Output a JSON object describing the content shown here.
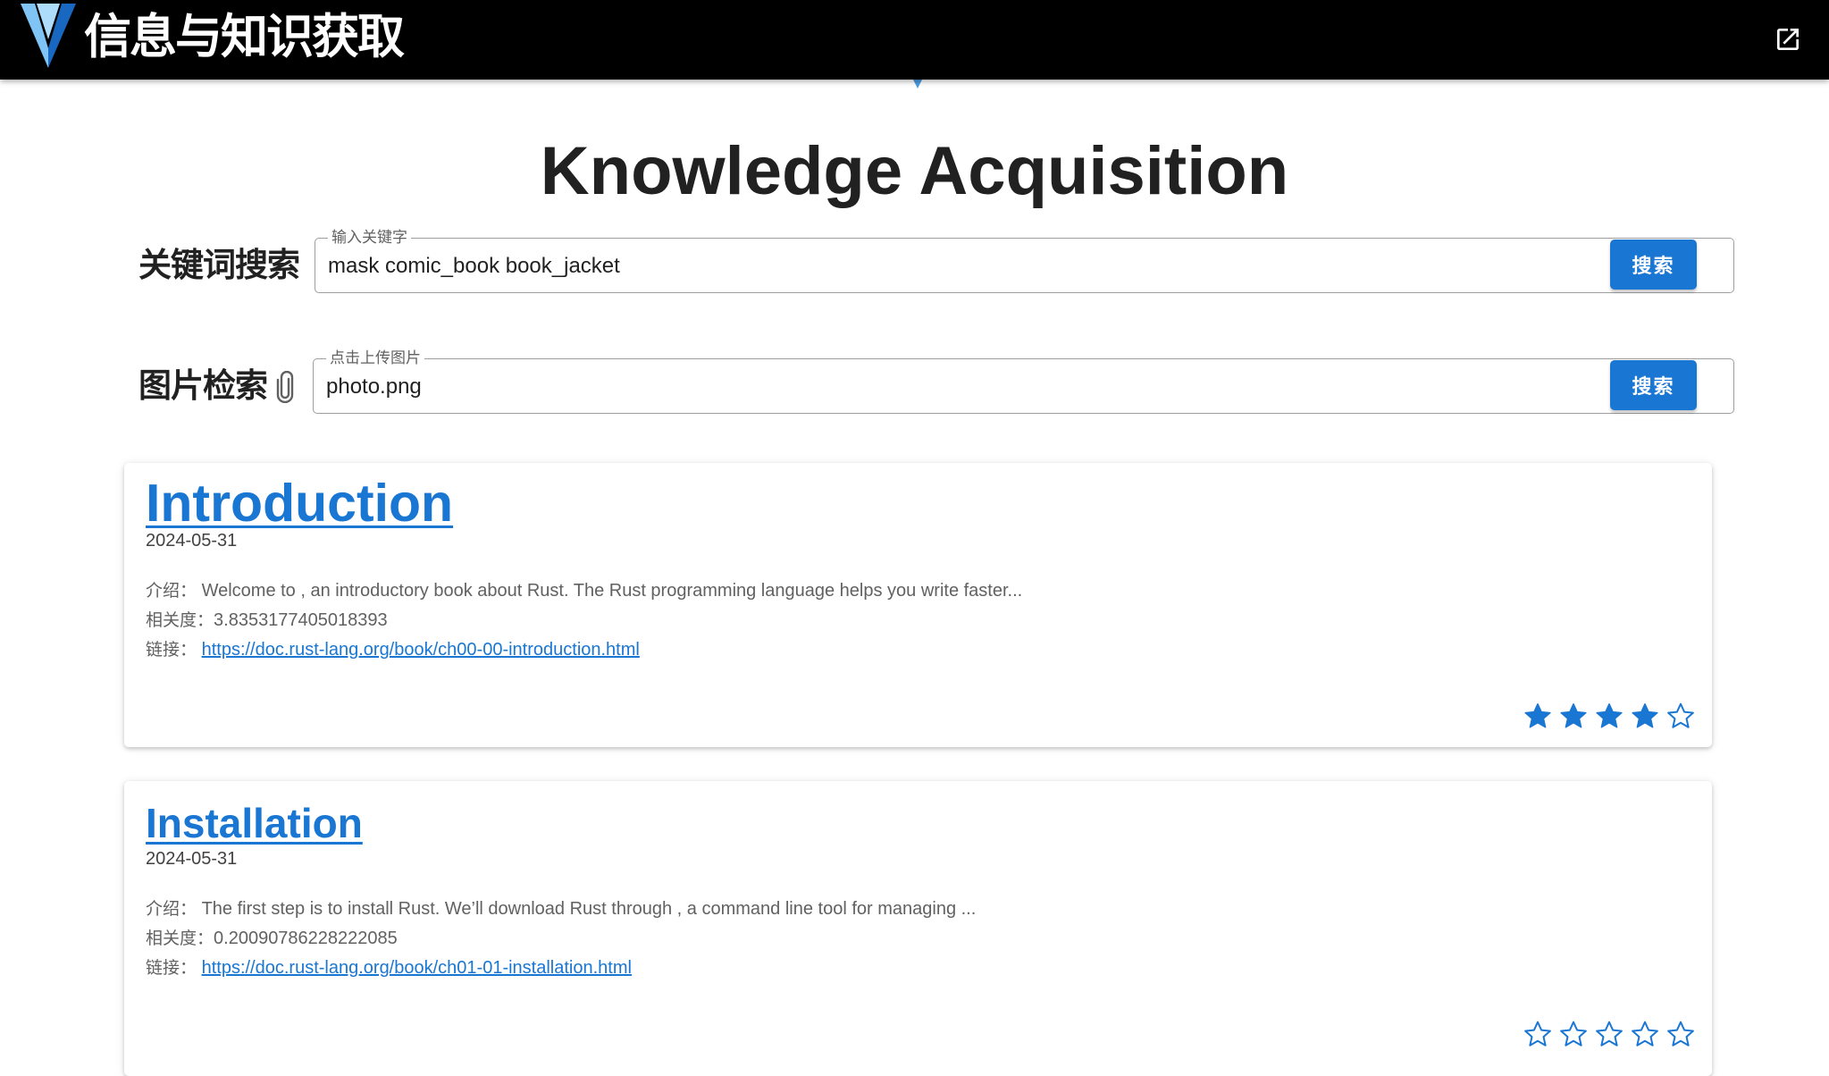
{
  "app_bar": {
    "title": "信息与知识获取",
    "logo_icon": "vuetify-logo-icon",
    "open_icon": "open-in-new-icon"
  },
  "page": {
    "title": "Knowledge Acquisition"
  },
  "keyword_search": {
    "label": "关键词搜索",
    "field_label": "输入关键字",
    "value": "mask comic_book book_jacket",
    "button_label": "搜索"
  },
  "image_search": {
    "label": "图片检索",
    "attach_icon": "paperclip-icon",
    "field_label": "点击上传图片",
    "value": "photo.png",
    "button_label": "搜索"
  },
  "results": [
    {
      "title": "Introduction",
      "date": "2024-05-31",
      "intro_label": "介绍：",
      "intro": "Welcome to , an introductory book about Rust. The Rust programming language helps you write faster...",
      "relevance_label": "相关度：",
      "relevance": "3.8353177405018393",
      "link_label": "链接：",
      "link": "https://doc.rust-lang.org/book/ch00-00-introduction.html",
      "rating": 4,
      "rating_max": 5
    },
    {
      "title": "Installation",
      "date": "2024-05-31",
      "intro_label": "介绍：",
      "intro": "The first step is to install Rust. We’ll download Rust through , a command line tool for managing ...",
      "relevance_label": "相关度：",
      "relevance": "0.20090786228222085",
      "link_label": "链接：",
      "link": "https://doc.rust-lang.org/book/ch01-01-installation.html",
      "rating": 0,
      "rating_max": 5
    }
  ],
  "colors": {
    "app_bar": "#000000",
    "primary": "#1976d2",
    "logo_light": "#7fc4f5",
    "logo_dark": "#1867c0"
  }
}
